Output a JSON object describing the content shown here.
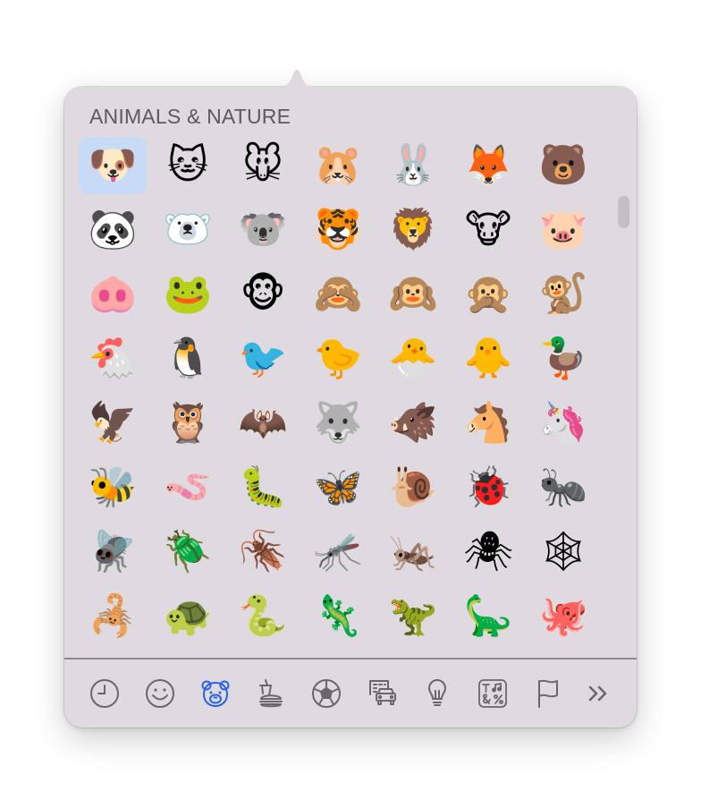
{
  "picker": {
    "section_title": "ANIMALS & NATURE",
    "selected_index": 0,
    "emojis": [
      {
        "name": "dog-face",
        "char": "🐶"
      },
      {
        "name": "cat-face",
        "char": "🐱"
      },
      {
        "name": "mouse-face",
        "char": "🐭"
      },
      {
        "name": "hamster",
        "char": "🐹"
      },
      {
        "name": "rabbit-face",
        "char": "🐰"
      },
      {
        "name": "fox",
        "char": "🦊"
      },
      {
        "name": "bear",
        "char": "🐻"
      },
      {
        "name": "panda",
        "char": "🐼"
      },
      {
        "name": "polar-bear",
        "char": "🐻‍❄️"
      },
      {
        "name": "koala",
        "char": "🐨"
      },
      {
        "name": "tiger-face",
        "char": "🐯"
      },
      {
        "name": "lion",
        "char": "🦁"
      },
      {
        "name": "cow-face",
        "char": "🐮"
      },
      {
        "name": "pig-face",
        "char": "🐷"
      },
      {
        "name": "pig-nose",
        "char": "🐽"
      },
      {
        "name": "frog",
        "char": "🐸"
      },
      {
        "name": "monkey-face",
        "char": "🐵"
      },
      {
        "name": "see-no-evil-monkey",
        "char": "🙈"
      },
      {
        "name": "hear-no-evil-monkey",
        "char": "🙉"
      },
      {
        "name": "speak-no-evil-monkey",
        "char": "🙊"
      },
      {
        "name": "monkey",
        "char": "🐒"
      },
      {
        "name": "chicken",
        "char": "🐔"
      },
      {
        "name": "penguin",
        "char": "🐧"
      },
      {
        "name": "bird",
        "char": "🐦"
      },
      {
        "name": "baby-chick",
        "char": "🐤"
      },
      {
        "name": "hatching-chick",
        "char": "🐣"
      },
      {
        "name": "front-facing-baby-chick",
        "char": "🐥"
      },
      {
        "name": "duck",
        "char": "🦆"
      },
      {
        "name": "eagle",
        "char": "🦅"
      },
      {
        "name": "owl",
        "char": "🦉"
      },
      {
        "name": "bat",
        "char": "🦇"
      },
      {
        "name": "wolf",
        "char": "🐺"
      },
      {
        "name": "boar",
        "char": "🐗"
      },
      {
        "name": "horse-face",
        "char": "🐴"
      },
      {
        "name": "unicorn",
        "char": "🦄"
      },
      {
        "name": "honeybee",
        "char": "🐝"
      },
      {
        "name": "worm",
        "char": "🪱"
      },
      {
        "name": "bug",
        "char": "🐛"
      },
      {
        "name": "butterfly",
        "char": "🦋"
      },
      {
        "name": "snail",
        "char": "🐌"
      },
      {
        "name": "lady-beetle",
        "char": "🐞"
      },
      {
        "name": "ant",
        "char": "🐜"
      },
      {
        "name": "fly",
        "char": "🪰"
      },
      {
        "name": "beetle",
        "char": "🪲"
      },
      {
        "name": "cockroach",
        "char": "🪳"
      },
      {
        "name": "mosquito",
        "char": "🦟"
      },
      {
        "name": "cricket",
        "char": "🦗"
      },
      {
        "name": "spider",
        "char": "🕷"
      },
      {
        "name": "spider-web",
        "char": "🕸"
      },
      {
        "name": "scorpion",
        "char": "🦂"
      },
      {
        "name": "turtle",
        "char": "🐢"
      },
      {
        "name": "snake",
        "char": "🐍"
      },
      {
        "name": "lizard",
        "char": "🦎"
      },
      {
        "name": "t-rex",
        "char": "🦖"
      },
      {
        "name": "sauropod",
        "char": "🦕"
      },
      {
        "name": "octopus",
        "char": "🐙"
      }
    ]
  },
  "category_tabs": [
    {
      "name": "frequently-used",
      "icon": "clock-icon",
      "active": false
    },
    {
      "name": "smileys-people",
      "icon": "smiley-icon",
      "active": false
    },
    {
      "name": "animals-nature",
      "icon": "bear-face-icon",
      "active": true
    },
    {
      "name": "food-drink",
      "icon": "burger-drink-icon",
      "active": false
    },
    {
      "name": "activity",
      "icon": "soccer-ball-icon",
      "active": false
    },
    {
      "name": "travel-places",
      "icon": "car-building-icon",
      "active": false
    },
    {
      "name": "objects",
      "icon": "lightbulb-icon",
      "active": false
    },
    {
      "name": "symbols",
      "icon": "symbols-icon",
      "active": false
    },
    {
      "name": "flags",
      "icon": "flag-icon",
      "active": false
    },
    {
      "name": "more",
      "icon": "double-chevron-right-icon",
      "active": false
    }
  ],
  "colors": {
    "icon_default": "#6a666c",
    "icon_active": "#2a62e0",
    "selected_bg": "#c7dbf7"
  }
}
